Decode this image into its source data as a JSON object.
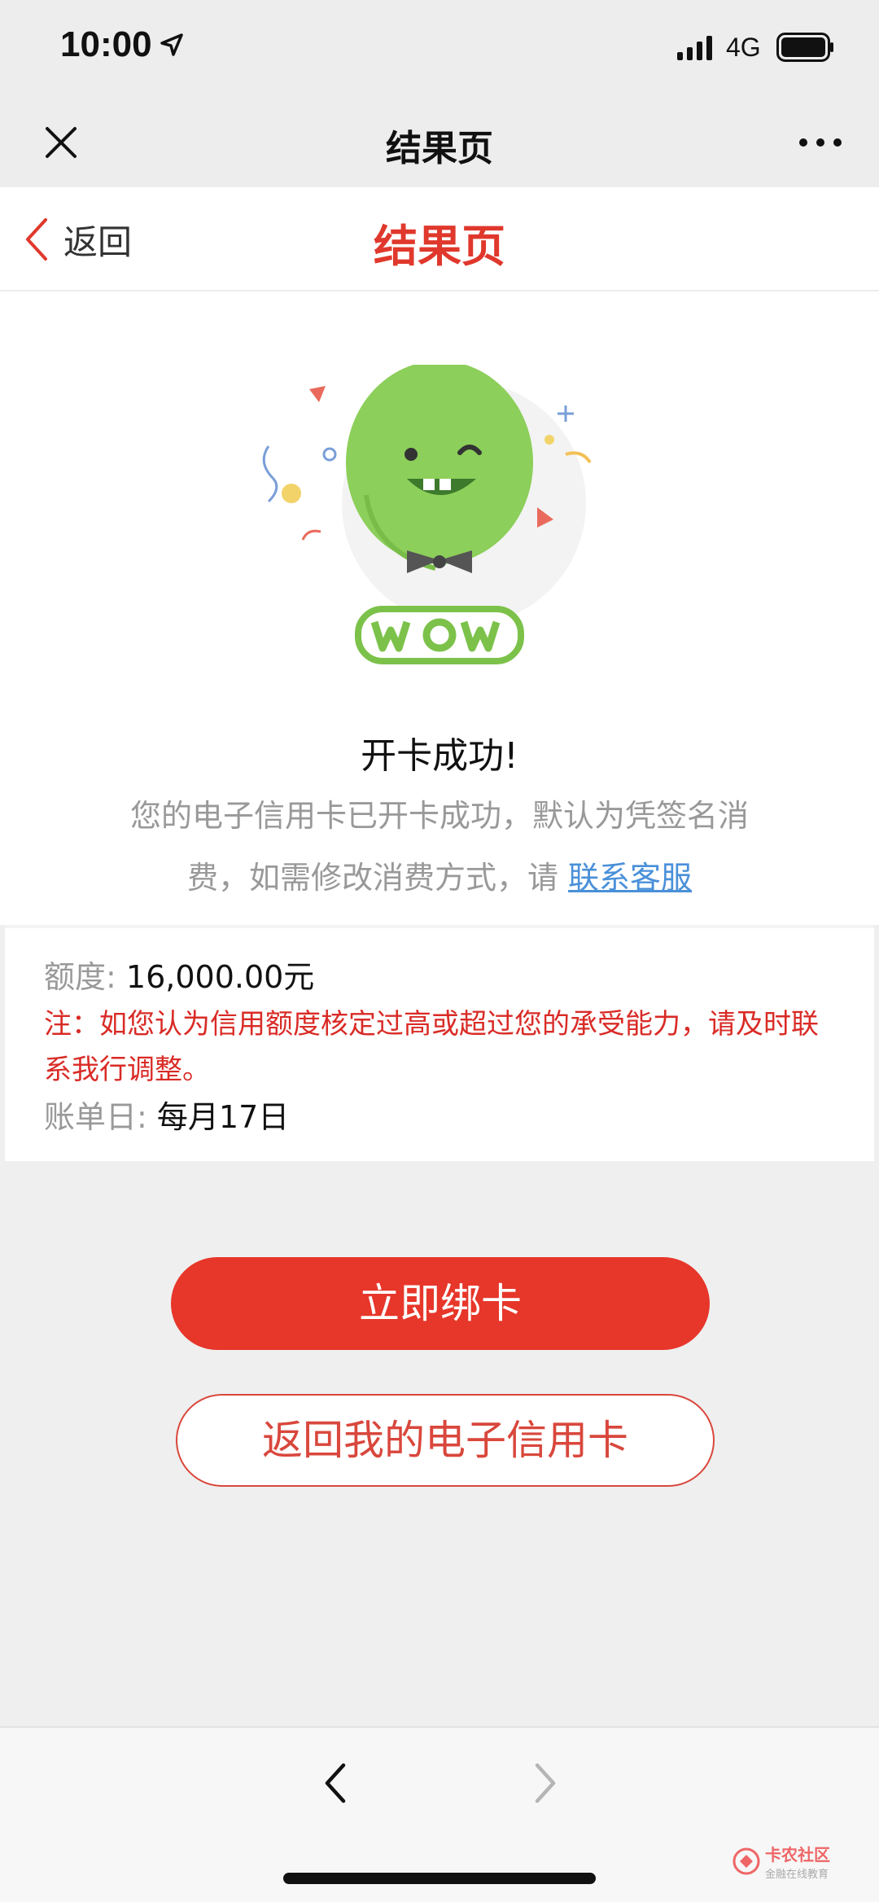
{
  "status_bar": {
    "time": "10:00",
    "network": "4G"
  },
  "wechat_nav": {
    "title": "结果页"
  },
  "header": {
    "back_label": "返回",
    "title": "结果页"
  },
  "result": {
    "heading": "开卡成功!",
    "description": "您的电子信用卡已开卡成功，默认为凭签名消费，如需修改消费方式，请",
    "contact_link": "联系客服"
  },
  "info": {
    "limit_label": "额度:",
    "limit_value": "16,000.00元",
    "note": "注：如您认为信用额度核定过高或超过您的承受能力，请及时联系我行调整。",
    "billing_label": "账单日:",
    "billing_value": "每月17日"
  },
  "buttons": {
    "bind_card": "立即绑卡",
    "return_card": "返回我的电子信用卡"
  },
  "watermark": {
    "title": "卡农社区",
    "subtitle": "金融在线教育"
  },
  "colors": {
    "accent": "#e7362a",
    "link": "#4a90d9",
    "note": "#d92b26",
    "balloon": "#8ccf5a"
  },
  "icons": [
    "location-arrow-icon",
    "signal-icon",
    "battery-icon",
    "close-icon",
    "more-icon",
    "chevron-left-icon",
    "chevron-right-icon"
  ]
}
